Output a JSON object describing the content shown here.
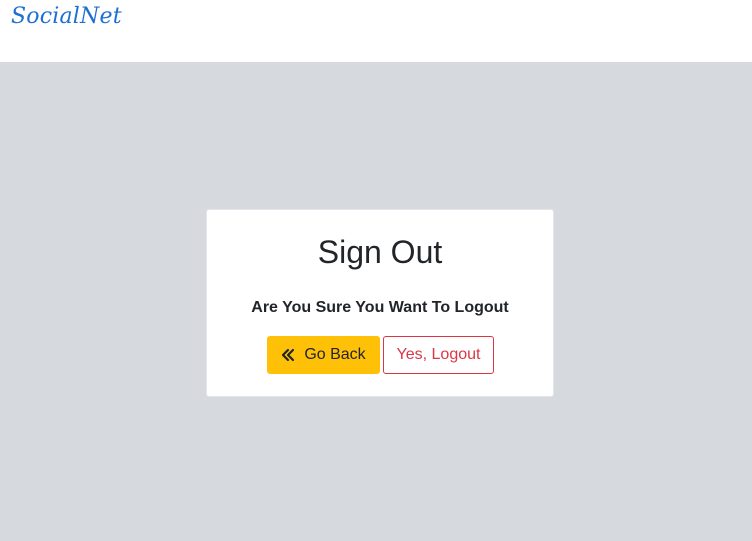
{
  "navbar": {
    "brand": "SocialNet"
  },
  "dialog": {
    "title": "Sign Out",
    "message": "Are You Sure You Want To Logout",
    "back_button": {
      "label": "Go Back",
      "icon": "angle-double-left-icon"
    },
    "logout_button": {
      "label": "Yes, Logout"
    }
  },
  "colors": {
    "brand": "#1d6fd1",
    "background": "#d6d9de",
    "warning": "#ffc107",
    "danger": "#dc3545"
  }
}
